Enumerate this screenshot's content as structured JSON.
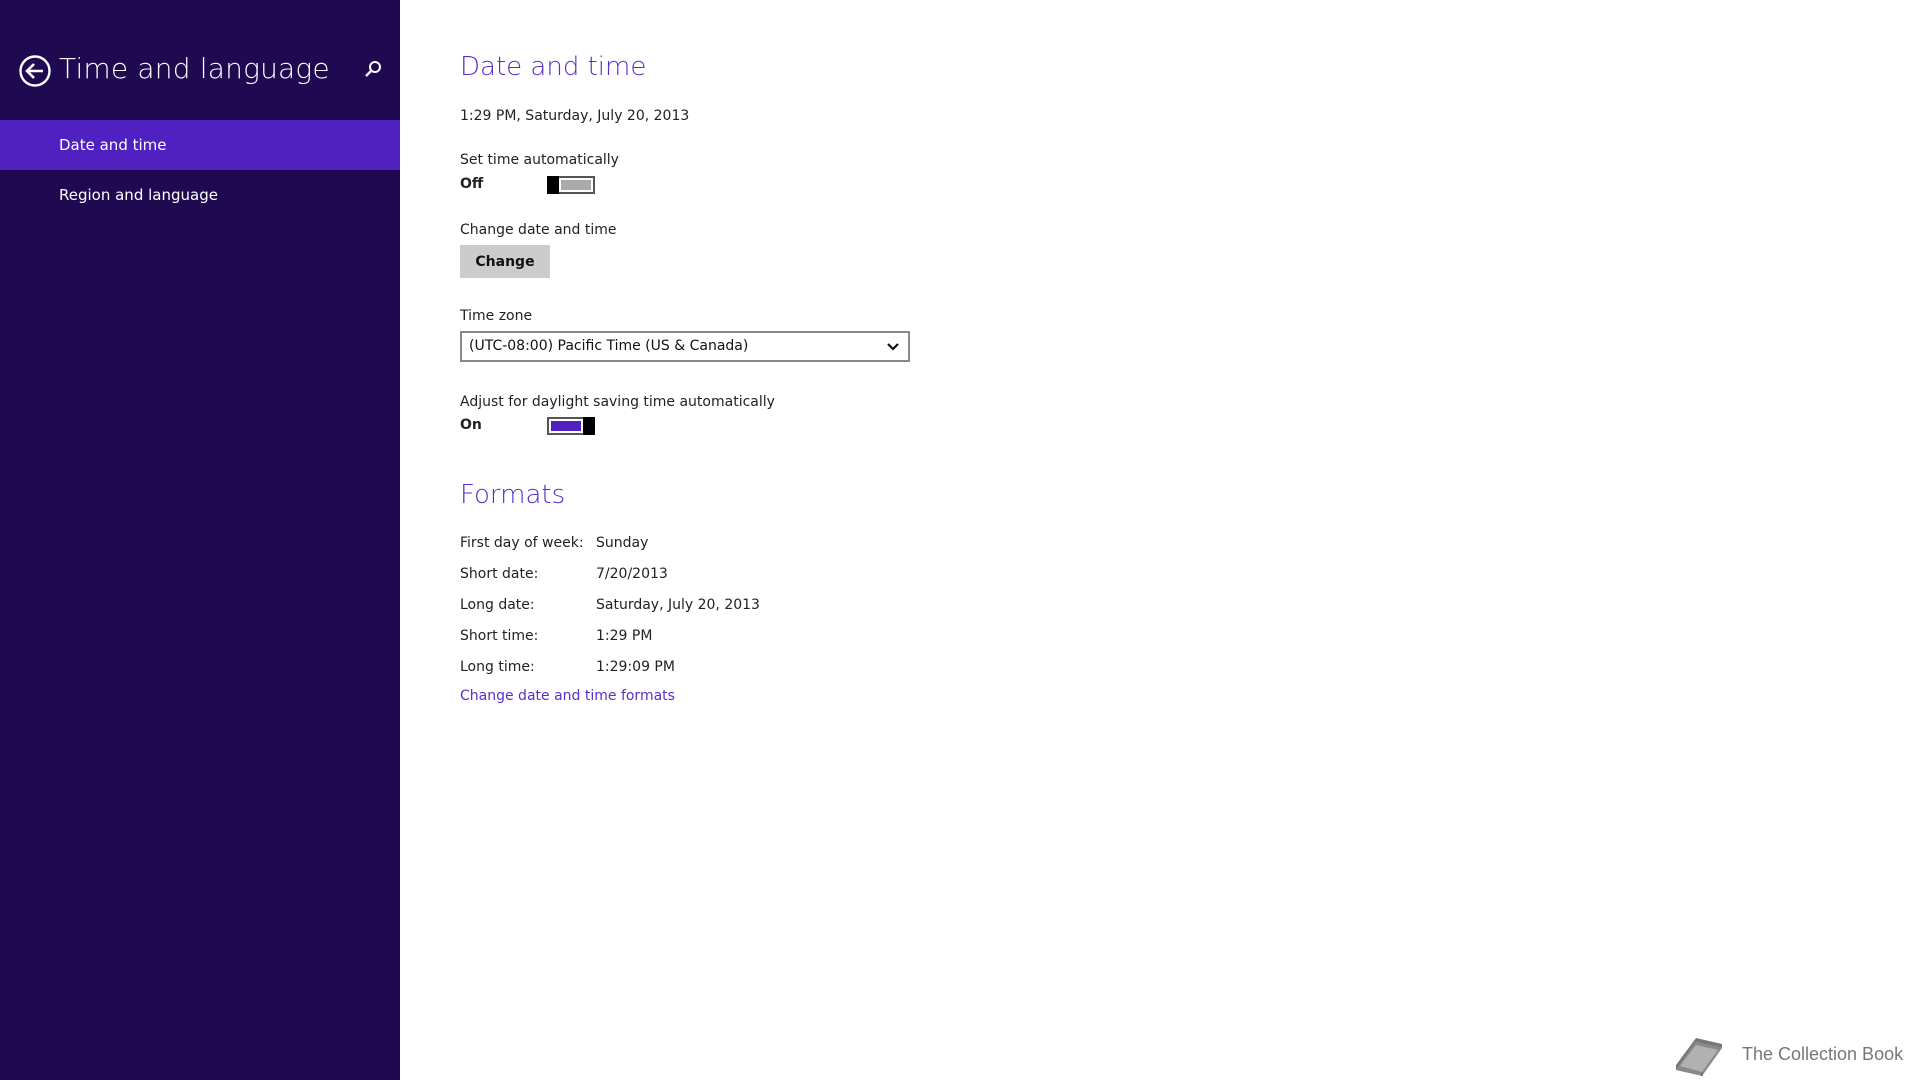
{
  "sidebar": {
    "title": "Time and language",
    "items": [
      {
        "label": "Date and time",
        "selected": true
      },
      {
        "label": "Region and language",
        "selected": false
      }
    ],
    "back_icon": "back-arrow-circle-icon",
    "search_icon": "search-icon"
  },
  "main": {
    "date_time_title": "Date and time",
    "current_datetime": "1:29 PM, Saturday, July 20, 2013",
    "set_time_auto": {
      "label": "Set time automatically",
      "state": "Off",
      "on": false
    },
    "change_date_time": {
      "label": "Change date and time",
      "button": "Change"
    },
    "time_zone": {
      "label": "Time zone",
      "value": "(UTC-08:00) Pacific Time (US & Canada)"
    },
    "daylight_saving": {
      "label": "Adjust for daylight saving time automatically",
      "state": "On",
      "on": true
    },
    "formats_title": "Formats",
    "formats": [
      {
        "label": "First day of week:",
        "value": "Sunday"
      },
      {
        "label": "Short date:",
        "value": "7/20/2013"
      },
      {
        "label": "Long date:",
        "value": "Saturday, July 20, 2013"
      },
      {
        "label": "Short time:",
        "value": "1:29 PM"
      },
      {
        "label": "Long time:",
        "value": "1:29:09 PM"
      }
    ],
    "formats_link": "Change date and time formats"
  },
  "watermark": {
    "text": "The Collection Book",
    "icon": "book-icon"
  },
  "colors": {
    "sidebar_bg": "#1f0a52",
    "selected_item": "#5020c0",
    "accent": "#5a2ec9",
    "toggle_on": "#5020c0",
    "toggle_off": "#aaaaaa"
  }
}
